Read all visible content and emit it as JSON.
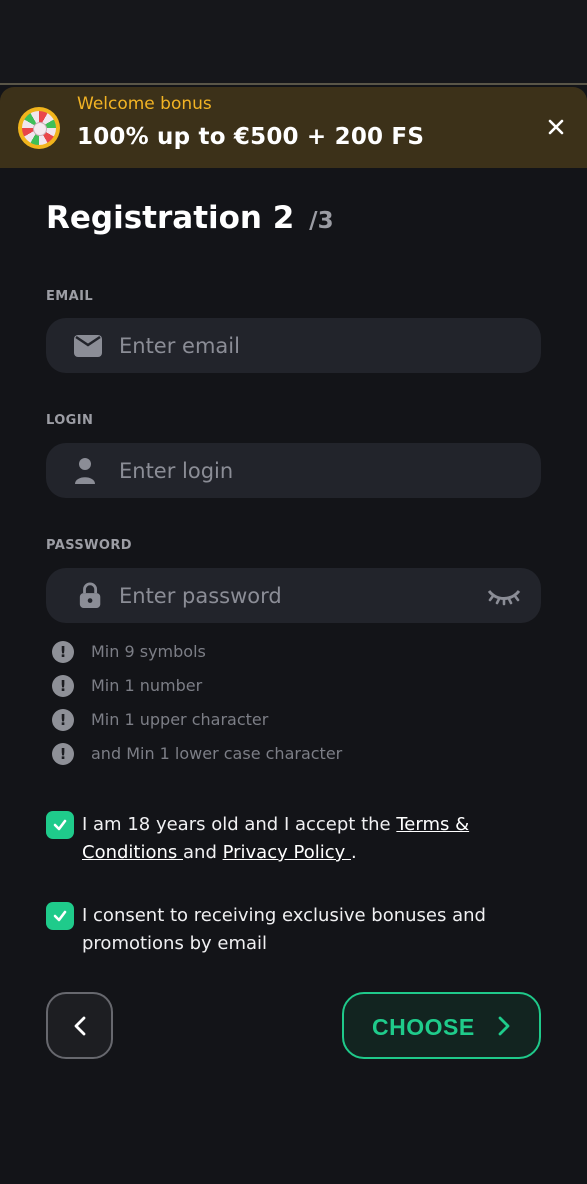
{
  "bonus_banner": {
    "subtitle": "Welcome bonus",
    "title": "100% up to €500 + 200 FS",
    "icon": "fortune-wheel-icon",
    "close_icon": "close-icon",
    "accent_color": "#f2b324"
  },
  "page": {
    "title": "Registration 2",
    "step": "/3"
  },
  "form": {
    "email": {
      "label": "EMAIL",
      "placeholder": "Enter email",
      "value": "",
      "icon": "envelope-icon"
    },
    "login": {
      "label": "LOGIN",
      "placeholder": "Enter login",
      "value": "",
      "icon": "user-icon"
    },
    "password": {
      "label": "PASSWORD",
      "placeholder": "Enter password",
      "value": "",
      "icon": "lock-icon",
      "toggle_icon": "eye-closed-icon"
    },
    "password_rules": [
      "Min 9 symbols",
      "Min 1 number",
      "Min 1 upper character",
      "and Min 1 lower case character"
    ]
  },
  "consents": {
    "terms": {
      "checked": true,
      "text_before": "I am 18 years old and I accept the ",
      "terms_link": "Terms & Conditions ",
      "text_middle": "and ",
      "privacy_link": "Privacy Policy ",
      "text_after": "."
    },
    "marketing": {
      "checked": true,
      "text": "I consent to receiving exclusive bonuses and promotions by email"
    }
  },
  "actions": {
    "back_icon": "chevron-left-icon",
    "choose_label": "CHOOSE",
    "choose_icon": "chevron-right-icon",
    "accent_color": "#1fcb8b"
  }
}
